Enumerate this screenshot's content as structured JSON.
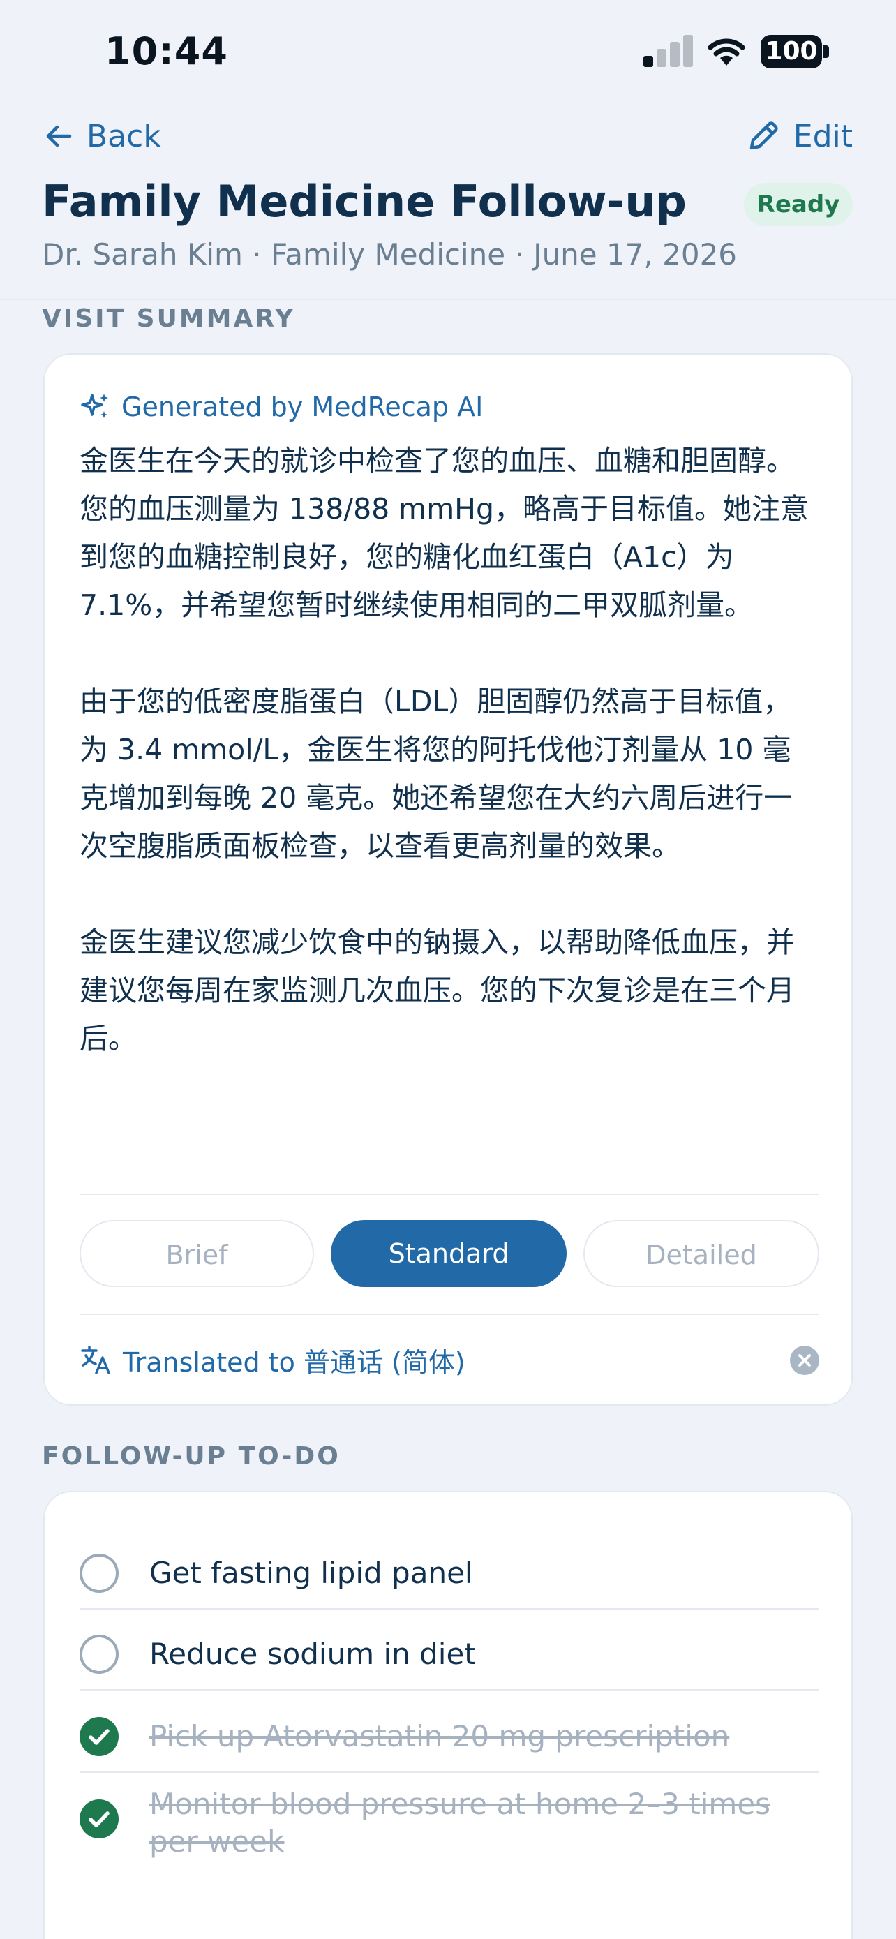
{
  "status_bar": {
    "time": "10:44",
    "battery": "100"
  },
  "nav": {
    "back_label": "Back",
    "edit_label": "Edit"
  },
  "header": {
    "title": "Family Medicine Follow-up",
    "status_badge": "Ready",
    "subtitle": "Dr. Sarah Kim · Family Medicine · June 17, 2026"
  },
  "visit_summary": {
    "section_label": "VISIT SUMMARY",
    "ai_label": "Generated by MedRecap AI",
    "paragraphs": [
      "金医生在今天的就诊中检查了您的血压、血糖和胆固醇。您的血压测量为 138/88 mmHg，略高于目标值。她注意到您的血糖控制良好，您的糖化血红蛋白（A1c）为 7.1%，并希望您暂时继续使用相同的二甲双胍剂量。",
      "由于您的低密度脂蛋白（LDL）胆固醇仍然高于目标值，为 3.4 mmol/L，金医生将您的阿托伐他汀剂量从 10 毫克增加到每晚 20 毫克。她还希望您在大约六周后进行一次空腹脂质面板检查，以查看更高剂量的效果。",
      "金医生建议您减少饮食中的钠摄入，以帮助降低血压，并建议您每周在家监测几次血压。您的下次复诊是在三个月后。"
    ],
    "detail_levels": [
      "Brief",
      "Standard",
      "Detailed"
    ],
    "selected_level": "Standard",
    "translation_label": "Translated to 普通话 (简体)"
  },
  "follow_up": {
    "section_label": "FOLLOW-UP TO-DO",
    "items": [
      {
        "text": "Get fasting lipid panel",
        "done": false
      },
      {
        "text": "Reduce sodium in diet",
        "done": false
      },
      {
        "text": "Pick up Atorvastatin 20 mg prescription",
        "done": true
      },
      {
        "text": "Monitor blood pressure at home 2–3 times per week",
        "done": true
      }
    ]
  },
  "colors": {
    "accent": "#2269a8",
    "ready_badge_bg": "#e0f3ea",
    "ready_badge_text": "#1e7a4e",
    "background": "#eff3f9"
  },
  "icons": {
    "back": "arrow-left-icon",
    "edit": "pencil-icon",
    "ai": "sparkles-icon",
    "translate": "translate-icon",
    "clear": "close-circle-icon",
    "unchecked": "empty-circle-icon",
    "checked": "check-circle-icon"
  }
}
